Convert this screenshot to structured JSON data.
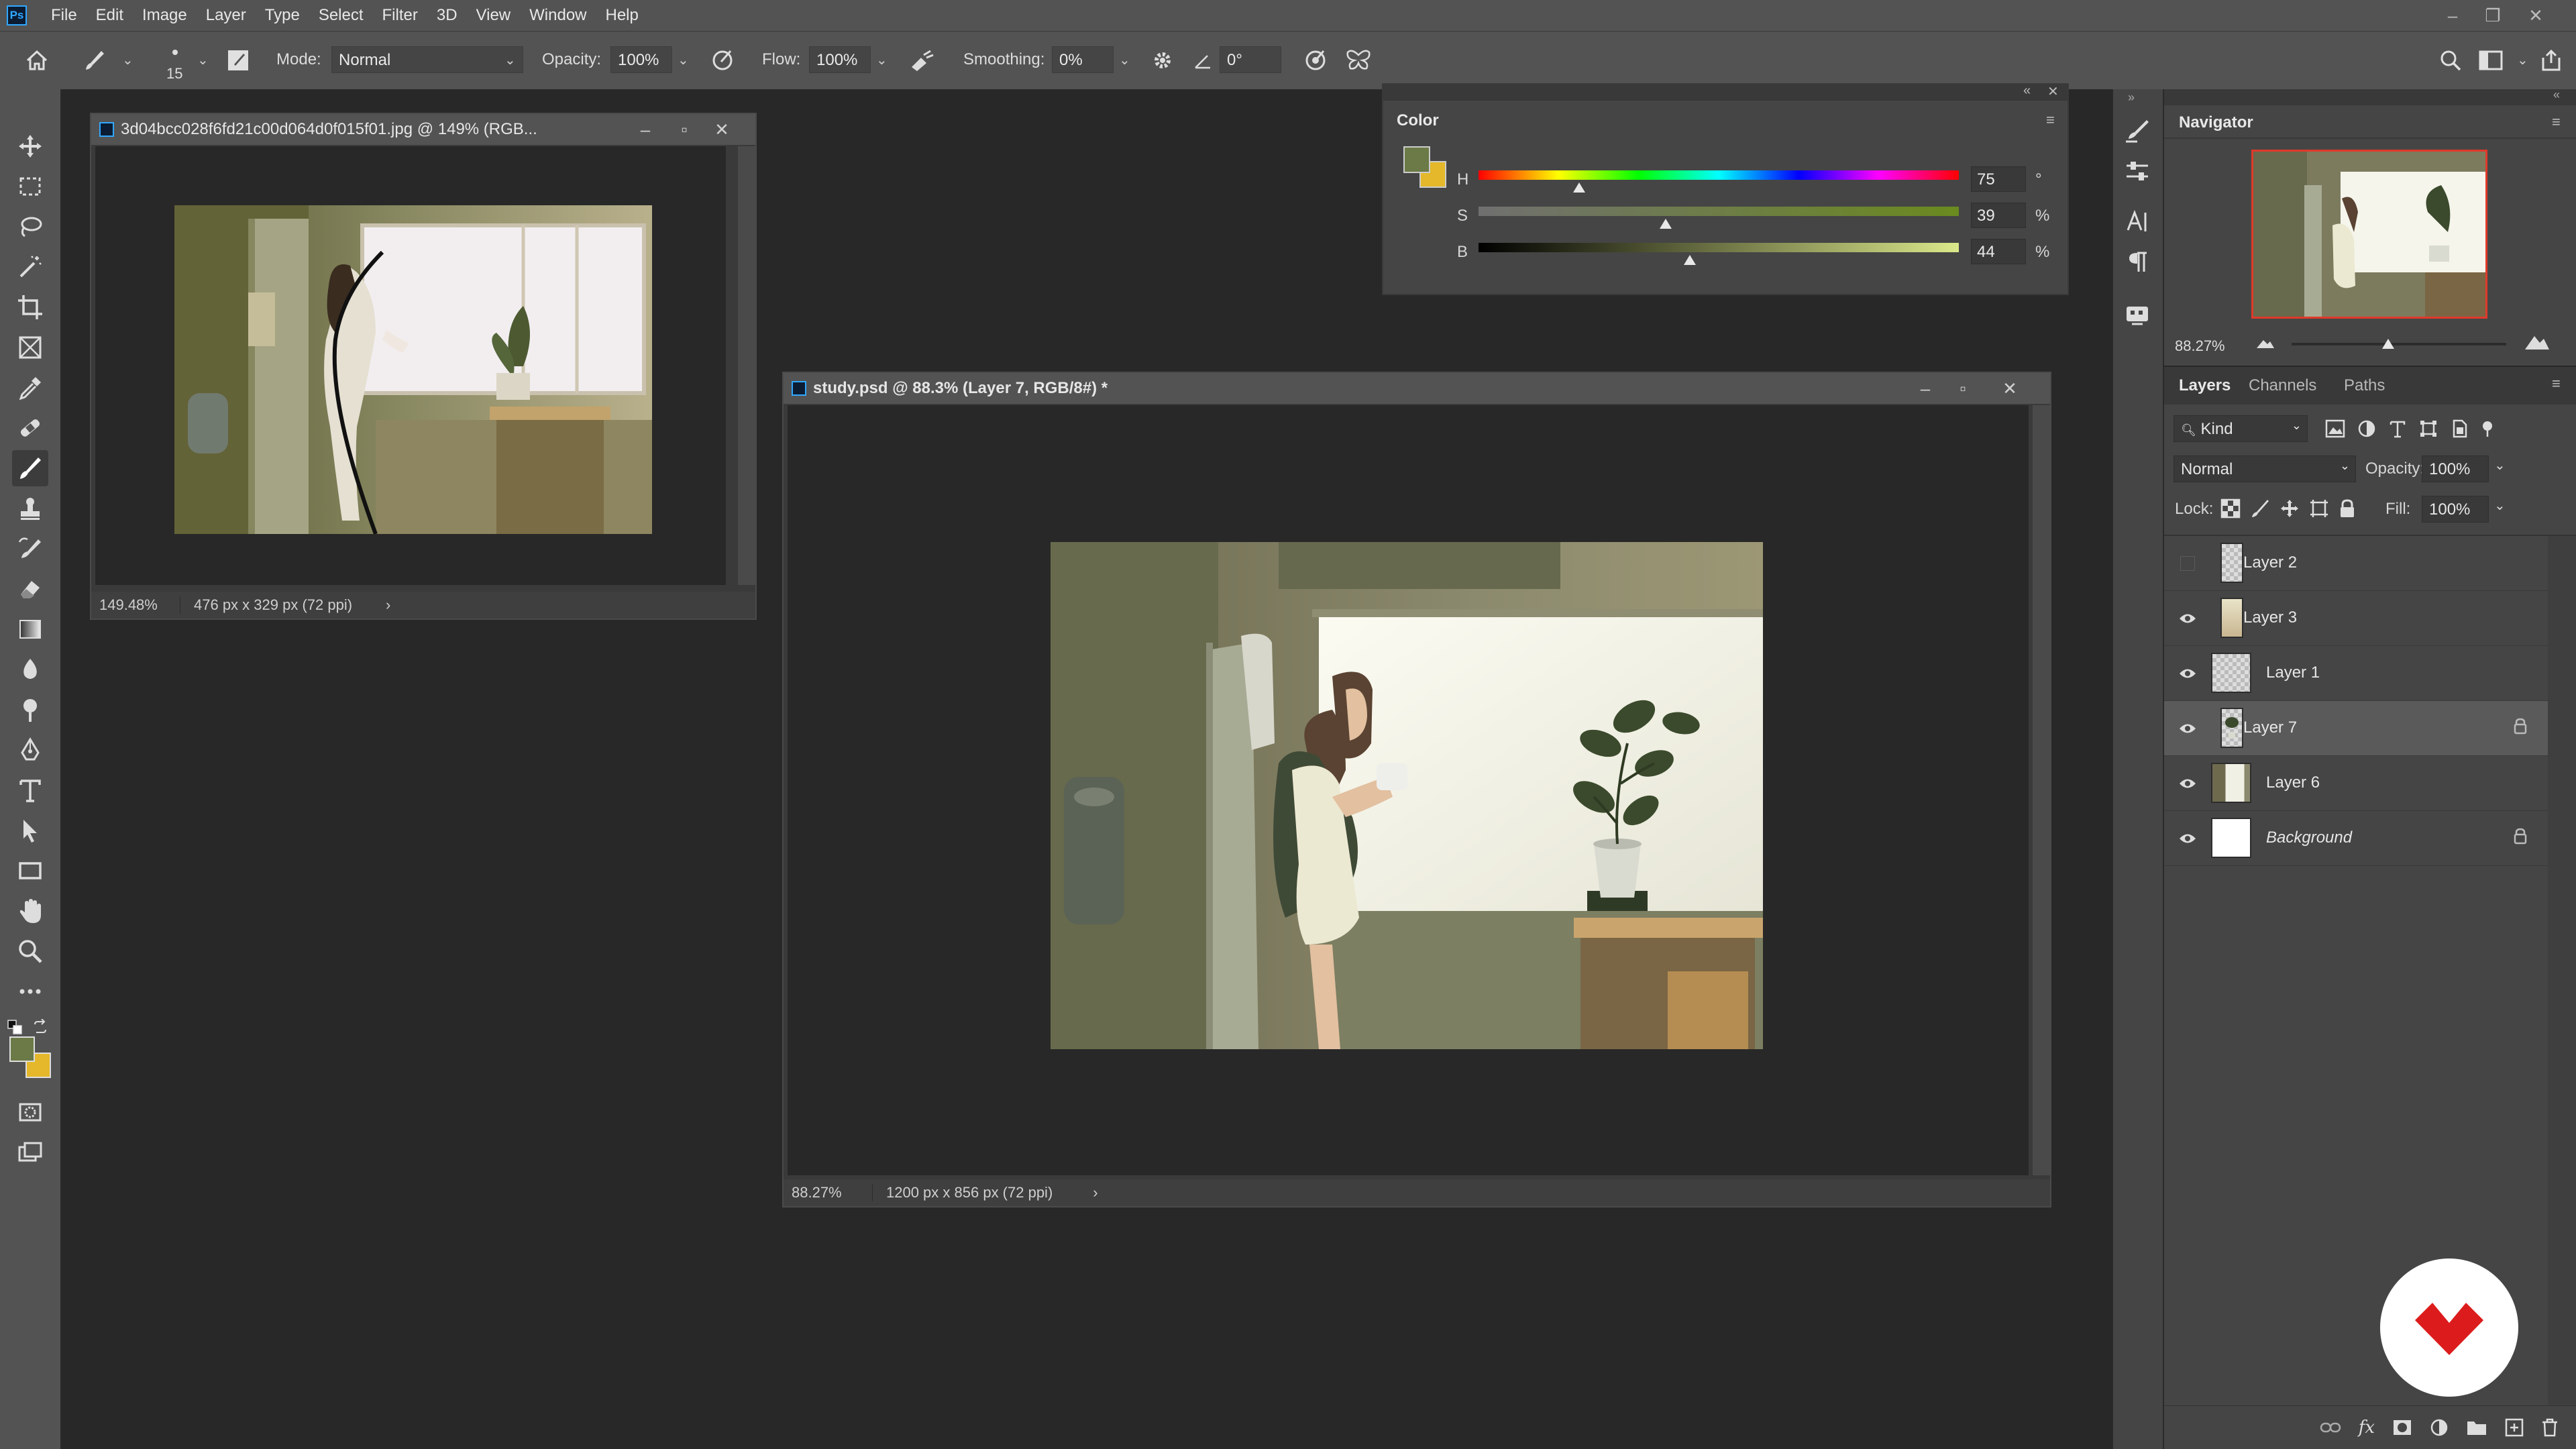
{
  "app": {
    "logo": "Ps",
    "menus": [
      "File",
      "Edit",
      "Image",
      "Layer",
      "Type",
      "Select",
      "Filter",
      "3D",
      "View",
      "Window",
      "Help"
    ]
  },
  "options_bar": {
    "brush_size": "15",
    "mode_label": "Mode:",
    "mode_value": "Normal",
    "opacity_label": "Opacity:",
    "opacity_value": "100%",
    "flow_label": "Flow:",
    "flow_value": "100%",
    "smoothing_label": "Smoothing:",
    "smoothing_value": "0%",
    "angle_value": "0°"
  },
  "documents": {
    "reference": {
      "title": "3d04bcc028f6fd21c00d064d0f015f01.jpg @ 149% (RGB...",
      "zoom": "149.48%",
      "dimensions": "476 px x 329 px (72 ppi)"
    },
    "study": {
      "title": "study.psd @ 88.3% (Layer 7, RGB/8#) *",
      "zoom": "88.27%",
      "dimensions": "1200 px x 856 px (72 ppi)"
    }
  },
  "color_panel": {
    "title": "Color",
    "foreground": "#6b7a46",
    "background": "#e4b82a",
    "sliders": [
      {
        "label": "H",
        "value": "75",
        "unit": "°",
        "fraction": 0.21
      },
      {
        "label": "S",
        "value": "39",
        "unit": "%",
        "fraction": 0.39
      },
      {
        "label": "B",
        "value": "44",
        "unit": "%",
        "fraction": 0.44
      }
    ]
  },
  "navigator": {
    "title": "Navigator",
    "zoom": "88.27%",
    "zoom_fraction": 0.45
  },
  "layers_panel": {
    "tabs": [
      "Layers",
      "Channels",
      "Paths"
    ],
    "filter_kind": "Kind",
    "blend_mode": "Normal",
    "opacity_label": "Opacity:",
    "opacity_value": "100%",
    "lock_label": "Lock:",
    "fill_label": "Fill:",
    "fill_value": "100%",
    "layers": [
      {
        "name": "Layer 2",
        "visible": false,
        "selected": false,
        "locked": false,
        "thumb": "checker-sketch",
        "indent": true
      },
      {
        "name": "Layer 3",
        "visible": true,
        "selected": false,
        "locked": false,
        "thumb": "figure",
        "indent": true
      },
      {
        "name": "Layer 1",
        "visible": true,
        "selected": false,
        "locked": false,
        "thumb": "checker",
        "indent": false
      },
      {
        "name": "Layer 7",
        "visible": true,
        "selected": true,
        "locked": true,
        "thumb": "checker-plant",
        "indent": true
      },
      {
        "name": "Layer 6",
        "visible": true,
        "selected": false,
        "locked": false,
        "thumb": "scene",
        "indent": false
      },
      {
        "name": "Background",
        "visible": true,
        "selected": false,
        "locked": true,
        "thumb": "white",
        "indent": false
      }
    ]
  }
}
